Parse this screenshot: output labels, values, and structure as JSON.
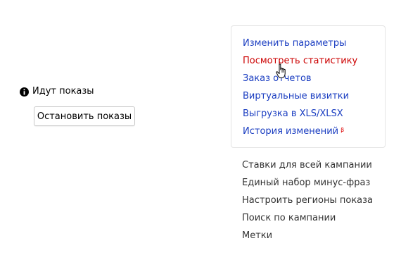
{
  "status": {
    "icon": "info-icon",
    "text": "Идут показы"
  },
  "stop_button": {
    "label": "Остановить показы"
  },
  "actions_panel": {
    "links": [
      {
        "label": "Изменить параметры",
        "state": "normal"
      },
      {
        "label": "Посмотреть статистику",
        "state": "hover"
      },
      {
        "label": "Заказ отчетов",
        "state": "normal"
      },
      {
        "label": "Виртуальные визитки",
        "state": "normal"
      },
      {
        "label": "Выгрузка в XLS/XLSX",
        "state": "normal"
      },
      {
        "label": "История изменений",
        "state": "normal",
        "badge": "β"
      }
    ]
  },
  "secondary_links": [
    {
      "label": "Ставки для всей кампании"
    },
    {
      "label": "Единый набор минус-фраз"
    },
    {
      "label": "Настроить регионы показа"
    },
    {
      "label": "Поиск по кампании"
    },
    {
      "label": "Метки"
    }
  ],
  "colors": {
    "link": "#1a3dc1",
    "link_hover": "#cc0000",
    "secondary_link": "#333333",
    "badge": "#dd0000",
    "panel_border": "#e4e4e4"
  },
  "cursor": {
    "icon": "hand-pointer-icon"
  }
}
